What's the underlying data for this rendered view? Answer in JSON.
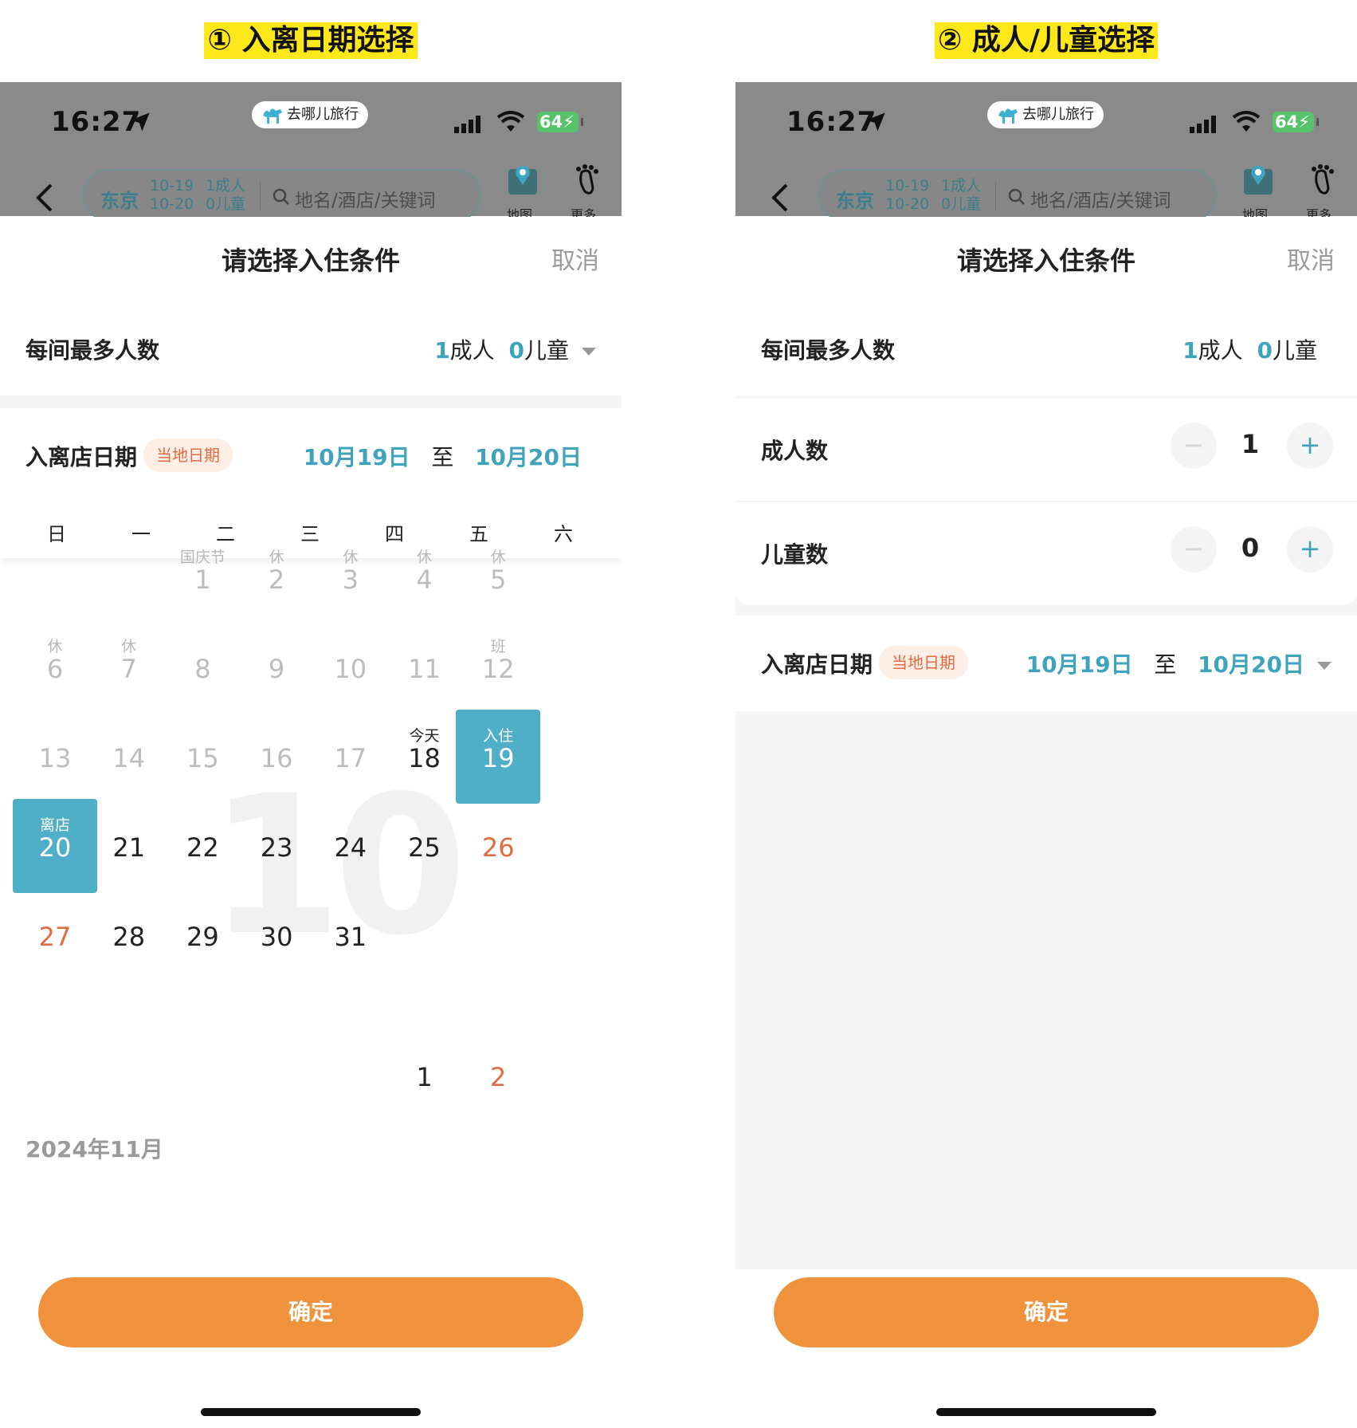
{
  "left": {
    "caption": "① 入离日期选择",
    "status": {
      "time": "16:27",
      "app": "去哪儿旅行",
      "battery": "64"
    },
    "search": {
      "city": "东京",
      "checkin": "10-19",
      "checkout": "10-20",
      "adults": "1成人",
      "children": "0儿童",
      "placeholder": "地名/酒店/关键词",
      "map": "地图",
      "more": "更多"
    },
    "sheet": {
      "title": "请选择入住条件",
      "cancel": "取消",
      "max_label": "每间最多人数",
      "adult_count": "1",
      "adult_unit": "成人",
      "child_count": "0",
      "child_unit": "儿童",
      "date_label": "入离店日期",
      "local_badge": "当地日期",
      "checkin": "10月19日",
      "to": "至",
      "checkout": "10月20日"
    },
    "weekdays": [
      "日",
      "一",
      "二",
      "三",
      "四",
      "五",
      "六"
    ],
    "watermark": "10",
    "october": [
      {
        "day": "1",
        "note": "国庆节",
        "state": "past"
      },
      {
        "day": "2",
        "note": "休",
        "state": "past"
      },
      {
        "day": "3",
        "note": "休",
        "state": "past"
      },
      {
        "day": "4",
        "note": "休",
        "state": "past"
      },
      {
        "day": "5",
        "note": "休",
        "state": "past"
      },
      {
        "day": "6",
        "note": "休",
        "state": "past"
      },
      {
        "day": "7",
        "note": "休",
        "state": "past"
      },
      {
        "day": "8",
        "note": "",
        "state": "past"
      },
      {
        "day": "9",
        "note": "",
        "state": "past"
      },
      {
        "day": "10",
        "note": "",
        "state": "past"
      },
      {
        "day": "11",
        "note": "",
        "state": "past"
      },
      {
        "day": "12",
        "note": "班",
        "state": "past"
      },
      {
        "day": "13",
        "note": "",
        "state": "past"
      },
      {
        "day": "14",
        "note": "",
        "state": "past"
      },
      {
        "day": "15",
        "note": "",
        "state": "past"
      },
      {
        "day": "16",
        "note": "",
        "state": "past"
      },
      {
        "day": "17",
        "note": "",
        "state": "past"
      },
      {
        "day": "18",
        "note": "今天",
        "state": "today"
      },
      {
        "day": "19",
        "note": "入住",
        "state": "sel"
      },
      {
        "day": "20",
        "note": "离店",
        "state": "sel"
      },
      {
        "day": "21",
        "note": "",
        "state": "normal"
      },
      {
        "day": "22",
        "note": "",
        "state": "normal"
      },
      {
        "day": "23",
        "note": "",
        "state": "normal"
      },
      {
        "day": "24",
        "note": "",
        "state": "normal"
      },
      {
        "day": "25",
        "note": "",
        "state": "normal"
      },
      {
        "day": "26",
        "note": "",
        "state": "weekend"
      },
      {
        "day": "27",
        "note": "",
        "state": "weekend"
      },
      {
        "day": "28",
        "note": "",
        "state": "normal"
      },
      {
        "day": "29",
        "note": "",
        "state": "normal"
      },
      {
        "day": "30",
        "note": "",
        "state": "normal"
      },
      {
        "day": "31",
        "note": "",
        "state": "normal"
      }
    ],
    "next_month": "2024年11月",
    "november": [
      {
        "day": "1",
        "note": "",
        "state": "normal"
      },
      {
        "day": "2",
        "note": "",
        "state": "weekend"
      }
    ],
    "confirm": "确定"
  },
  "right": {
    "caption": "② 成人/儿童选择",
    "status": {
      "time": "16:27",
      "app": "去哪儿旅行",
      "battery": "64"
    },
    "search": {
      "city": "东京",
      "checkin": "10-19",
      "checkout": "10-20",
      "adults": "1成人",
      "children": "0儿童",
      "placeholder": "地名/酒店/关键词",
      "map": "地图",
      "more": "更多"
    },
    "sheet": {
      "title": "请选择入住条件",
      "cancel": "取消",
      "max_label": "每间最多人数",
      "adult_count": "1",
      "adult_unit": "成人",
      "child_count": "0",
      "child_unit": "儿童",
      "date_label": "入离店日期",
      "local_badge": "当地日期",
      "checkin": "10月19日",
      "to": "至",
      "checkout": "10月20日"
    },
    "adults_label": "成人数",
    "adults_value": "1",
    "children_label": "儿童数",
    "children_value": "0",
    "minus": "−",
    "plus": "+",
    "confirm": "确定"
  }
}
